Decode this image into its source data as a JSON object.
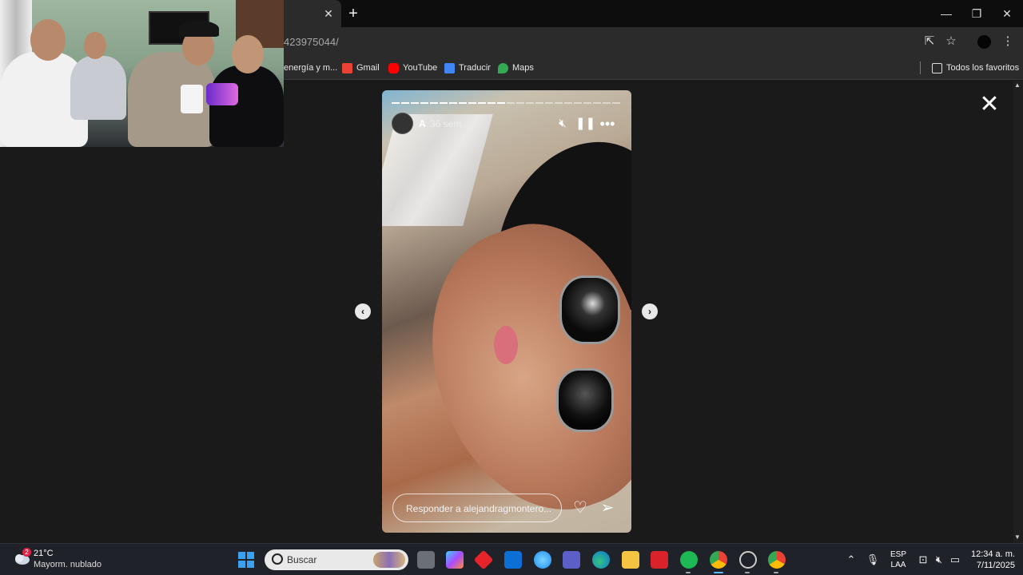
{
  "browser": {
    "tab_close": "✕",
    "new_tab": "+",
    "url": "423975044/",
    "window": {
      "minimize": "—",
      "restore": "❐",
      "close": "✕"
    },
    "bookmarks": [
      {
        "label": "energía y m...",
        "color": "#ffffff"
      },
      {
        "label": "Gmail",
        "color": "#ea4335"
      },
      {
        "label": "YouTube",
        "color": "#ff0000"
      },
      {
        "label": "Traducir",
        "color": "#4285f4"
      },
      {
        "label": "Maps",
        "color": "#34a853"
      }
    ],
    "all_bookmarks": "Todos los favoritos"
  },
  "story": {
    "username": "A",
    "time": "36 sem",
    "segments_total": 24,
    "segments_done": 12,
    "reply_placeholder": "Responder a alejandragmontero...",
    "icons": {
      "mute": "mute-icon",
      "pause": "pause-icon",
      "more": "more-icon",
      "like": "heart-icon",
      "send": "send-icon"
    }
  },
  "nav": {
    "prev": "‹",
    "next": "›",
    "close": "✕"
  },
  "taskbar": {
    "weather_badge": "2",
    "temperature": "21°C",
    "weather_desc": "Mayorm. nublado",
    "search_label": "Buscar",
    "lang_line1": "ESP",
    "lang_line2": "LAA",
    "time": "12:34 a. m.",
    "date": "7/11/2025"
  }
}
